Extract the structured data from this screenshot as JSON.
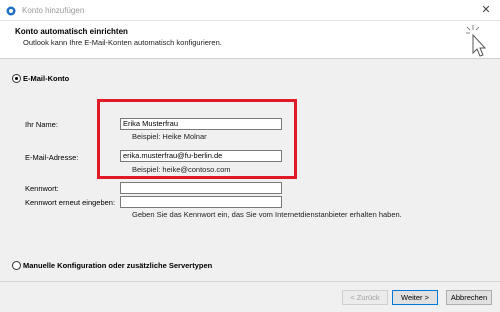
{
  "window": {
    "title": "Konto hinzufügen",
    "close_glyph": "✕"
  },
  "header": {
    "title": "Konto automatisch einrichten",
    "subtitle": "Outlook kann Ihre E-Mail-Konten automatisch konfigurieren."
  },
  "options": {
    "email_account": "E-Mail-Konto",
    "manual": "Manuelle Konfiguration oder zusätzliche Servertypen"
  },
  "form": {
    "name_label": "Ihr Name:",
    "name_value": "Erika Musterfrau",
    "name_example": "Beispiel: Heike Molnar",
    "email_label": "E-Mail-Adresse:",
    "email_value": "erika.musterfrau@fu-berlin.de",
    "email_example": "Beispiel: heike@contoso.com",
    "password_label": "Kennwort:",
    "password_confirm_label": "Kennwort erneut eingeben:",
    "password_hint": "Geben Sie das Kennwort ein, das Sie vom Internetdienstanbieter erhalten haben."
  },
  "buttons": {
    "back": "< Zurück",
    "next": "Weiter >",
    "cancel": "Abbrechen"
  },
  "colors": {
    "highlight": "#e01a24",
    "accent": "#0078d7"
  }
}
